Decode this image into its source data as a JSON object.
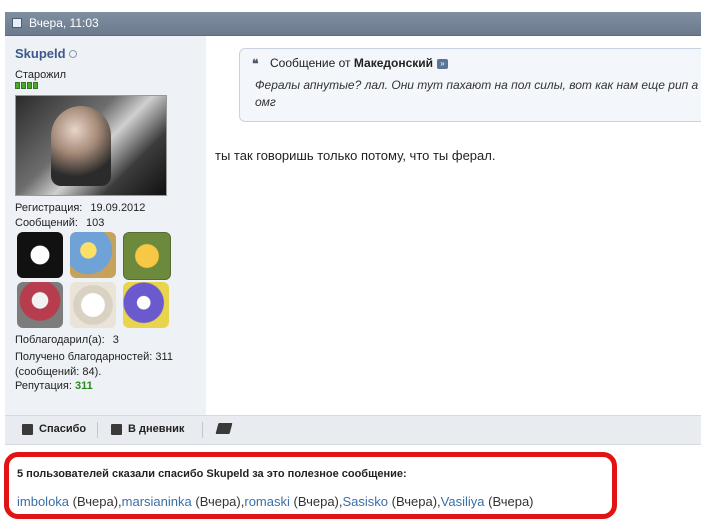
{
  "header": {
    "date": "Вчера, 11:03"
  },
  "user": {
    "name": "Skupeld",
    "title": "Старожил",
    "reg_label": "Регистрация:",
    "reg_value": "19.09.2012",
    "posts_label": "Сообщений:",
    "posts_value": "103",
    "thanked_label": "Поблагодарил(а):",
    "thanked_value": "3",
    "thanks_received": "Получено благодарностей: 311 (сообщений: 84).",
    "rep_label": "Репутация:",
    "rep_value": "311"
  },
  "quote": {
    "header_prefix": "Сообщение от",
    "author": "Македонский",
    "text": "Фералы апнутые? лал. Они тут пахают на пол силы, вот как нам еще рип а омг"
  },
  "post": {
    "message": "ты так говоришь только потому, что ты ферал."
  },
  "actions": {
    "thanks_label": "Спасибо",
    "diary_label": "В дневник"
  },
  "thanks_box": {
    "title": "5 пользователей сказали спасибо Skupeld за это полезное сообщение:",
    "users": [
      {
        "name": "imboloka",
        "when": "(Вчера)"
      },
      {
        "name": "marsianinka",
        "when": "(Вчера)"
      },
      {
        "name": "romaski",
        "when": "(Вчера)"
      },
      {
        "name": "Sasisko",
        "when": "(Вчера)"
      },
      {
        "name": "Vasiliya",
        "when": "(Вчера)"
      }
    ]
  }
}
